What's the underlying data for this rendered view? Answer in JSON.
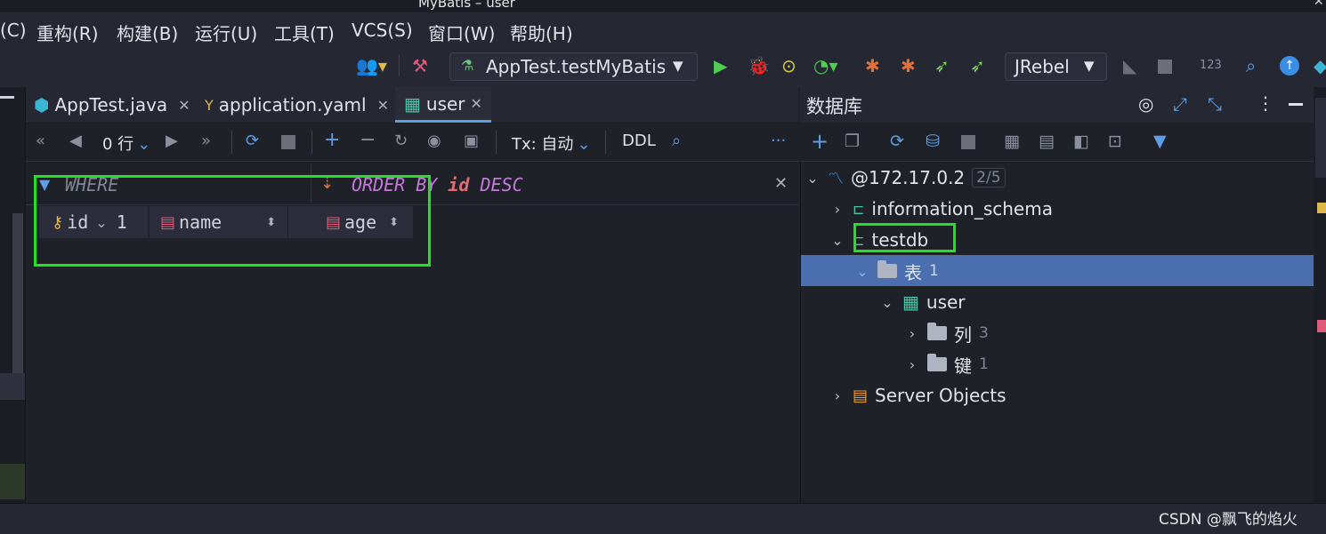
{
  "window": {
    "title": "MyBatis – user",
    "controls": [
      "˅",
      "˄",
      "✕"
    ]
  },
  "menu": [
    "(C)",
    "重构(R)",
    "构建(B)",
    "运行(U)",
    "工具(T)",
    "VCS(S)",
    "窗口(W)",
    "帮助(H)"
  ],
  "toolbar": {
    "run_config": "AppTest.testMyBatis",
    "jrebel": "JRebel",
    "counter": "123"
  },
  "tabs": [
    {
      "label": "AppTest.java",
      "icon": "java-class-icon"
    },
    {
      "label": "application.yaml",
      "icon": "yaml-icon"
    },
    {
      "label": "user",
      "icon": "table-icon",
      "active": true
    }
  ],
  "editor_toolbar": {
    "rows": "0 行",
    "tx_label": "Tx: 自动",
    "ddl": "DDL"
  },
  "filter": {
    "where": "WHERE",
    "order_kw1": "ORDER BY",
    "order_col": "id",
    "order_kw2": "DESC"
  },
  "columns": [
    {
      "name": "id",
      "extra": "1",
      "icon": "key-icon"
    },
    {
      "name": "name",
      "icon": "column-icon"
    },
    {
      "name": "age",
      "icon": "column-icon"
    }
  ],
  "database": {
    "title": "数据库",
    "tree": {
      "connection": "@172.17.0.2",
      "connection_count": "2/5",
      "schemas": [
        "information_schema",
        "testdb"
      ],
      "tables_folder": "表",
      "tables_count": "1",
      "table": "user",
      "columns_folder": "列",
      "columns_count": "3",
      "keys_folder": "键",
      "keys_count": "1",
      "server_objects": "Server Objects"
    }
  },
  "watermark": "CSDN @飘飞的焰火",
  "colors": {
    "accent": "#5c9ee8",
    "highlight": "#22e322",
    "selection": "#4b6eaf"
  }
}
